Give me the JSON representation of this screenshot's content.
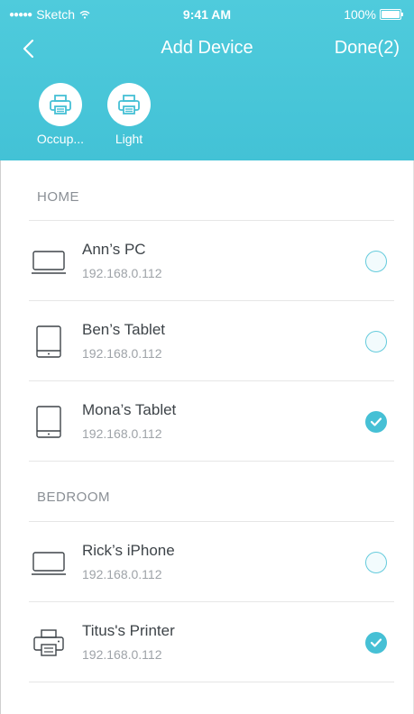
{
  "status_bar": {
    "carrier": "Sketch",
    "time": "9:41 AM",
    "battery": "100%"
  },
  "nav": {
    "title": "Add Device",
    "done_label": "Done(2)"
  },
  "quick_items": [
    {
      "label": "Occup...",
      "icon": "printer-icon"
    },
    {
      "label": "Light",
      "icon": "printer-icon"
    }
  ],
  "sections": [
    {
      "title": "HOME",
      "devices": [
        {
          "name": "Ann’s PC",
          "ip": "192.168.0.112",
          "icon": "laptop-icon",
          "selected": false
        },
        {
          "name": "Ben’s Tablet",
          "ip": "192.168.0.112",
          "icon": "tablet-icon",
          "selected": false
        },
        {
          "name": "Mona’s Tablet",
          "ip": "192.168.0.112",
          "icon": "tablet-icon",
          "selected": true
        }
      ]
    },
    {
      "title": "BEDROOM",
      "devices": [
        {
          "name": "Rick’s iPhone",
          "ip": "192.168.0.112",
          "icon": "laptop-icon",
          "selected": false
        },
        {
          "name": "Titus's Printer",
          "ip": "192.168.0.112",
          "icon": "printer-icon",
          "selected": true
        }
      ]
    }
  ],
  "colors": {
    "header": "#4fcbdc",
    "accent": "#46c0d5",
    "text_primary": "#3e4449",
    "text_secondary": "#9ea3a8"
  }
}
